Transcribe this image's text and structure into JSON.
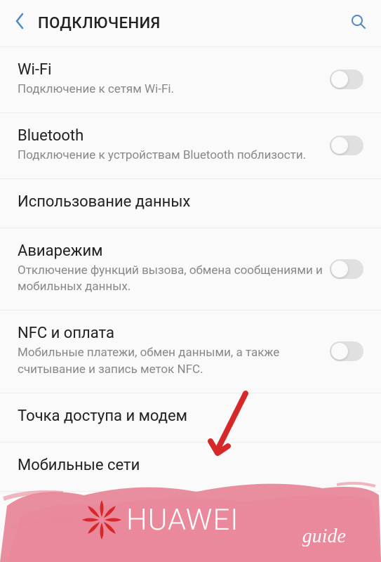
{
  "header": {
    "title": "ПОДКЛЮЧЕНИЯ"
  },
  "settings": [
    {
      "title": "Wi-Fi",
      "subtitle": "Подключение к сетям Wi-Fi.",
      "hasToggle": true
    },
    {
      "title": "Bluetooth",
      "subtitle": "Подключение к устройствам Bluetooth поблизости.",
      "hasToggle": true
    },
    {
      "title": "Использование данных",
      "subtitle": "",
      "hasToggle": false
    },
    {
      "title": "Авиарежим",
      "subtitle": "Отключение функций вызова, обмена сообщениями и мобильных данных.",
      "hasToggle": true
    },
    {
      "title": "NFC и оплата",
      "subtitle": "Мобильные платежи, обмен данными, а также считывание и запись меток NFC.",
      "hasToggle": true
    },
    {
      "title": "Точка доступа и модем",
      "subtitle": "",
      "hasToggle": false
    },
    {
      "title": "Мобильные сети",
      "subtitle": "",
      "hasToggle": false
    }
  ],
  "watermark": {
    "brand": "HUAWEI",
    "suffix": "guide"
  }
}
